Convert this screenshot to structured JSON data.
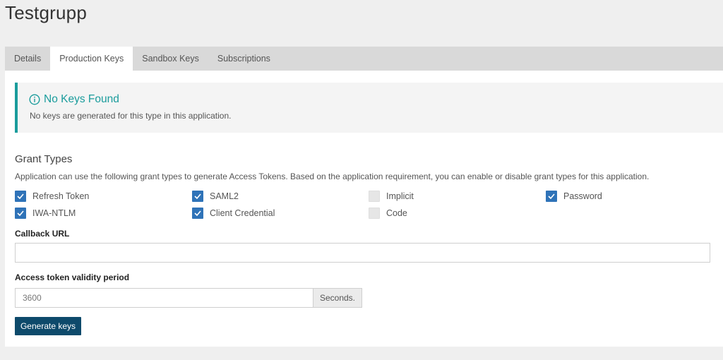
{
  "page": {
    "title": "Testgrupp"
  },
  "tabs": [
    {
      "label": "Details",
      "active": false
    },
    {
      "label": "Production Keys",
      "active": true
    },
    {
      "label": "Sandbox Keys",
      "active": false
    },
    {
      "label": "Subscriptions",
      "active": false
    }
  ],
  "alert": {
    "icon": "info-circle-icon",
    "title": "No Keys Found",
    "message": "No keys are generated for this type in this application.",
    "accent_color": "#1a9c9c"
  },
  "grant_types": {
    "title": "Grant Types",
    "description": "Application can use the following grant types to generate Access Tokens. Based on the application requirement, you can enable or disable grant types for this application.",
    "items": [
      {
        "label": "Refresh Token",
        "checked": true
      },
      {
        "label": "SAML2",
        "checked": true
      },
      {
        "label": "Implicit",
        "checked": false
      },
      {
        "label": "Password",
        "checked": true
      },
      {
        "label": "IWA-NTLM",
        "checked": true
      },
      {
        "label": "Client Credential",
        "checked": true
      },
      {
        "label": "Code",
        "checked": false
      }
    ]
  },
  "callback": {
    "label": "Callback URL",
    "value": "",
    "placeholder": ""
  },
  "validity": {
    "label": "Access token validity period",
    "value": "3600",
    "unit": "Seconds."
  },
  "actions": {
    "generate_label": "Generate keys",
    "button_color": "#0e4a6b"
  },
  "colors": {
    "checkbox_checked": "#2f73b8"
  }
}
